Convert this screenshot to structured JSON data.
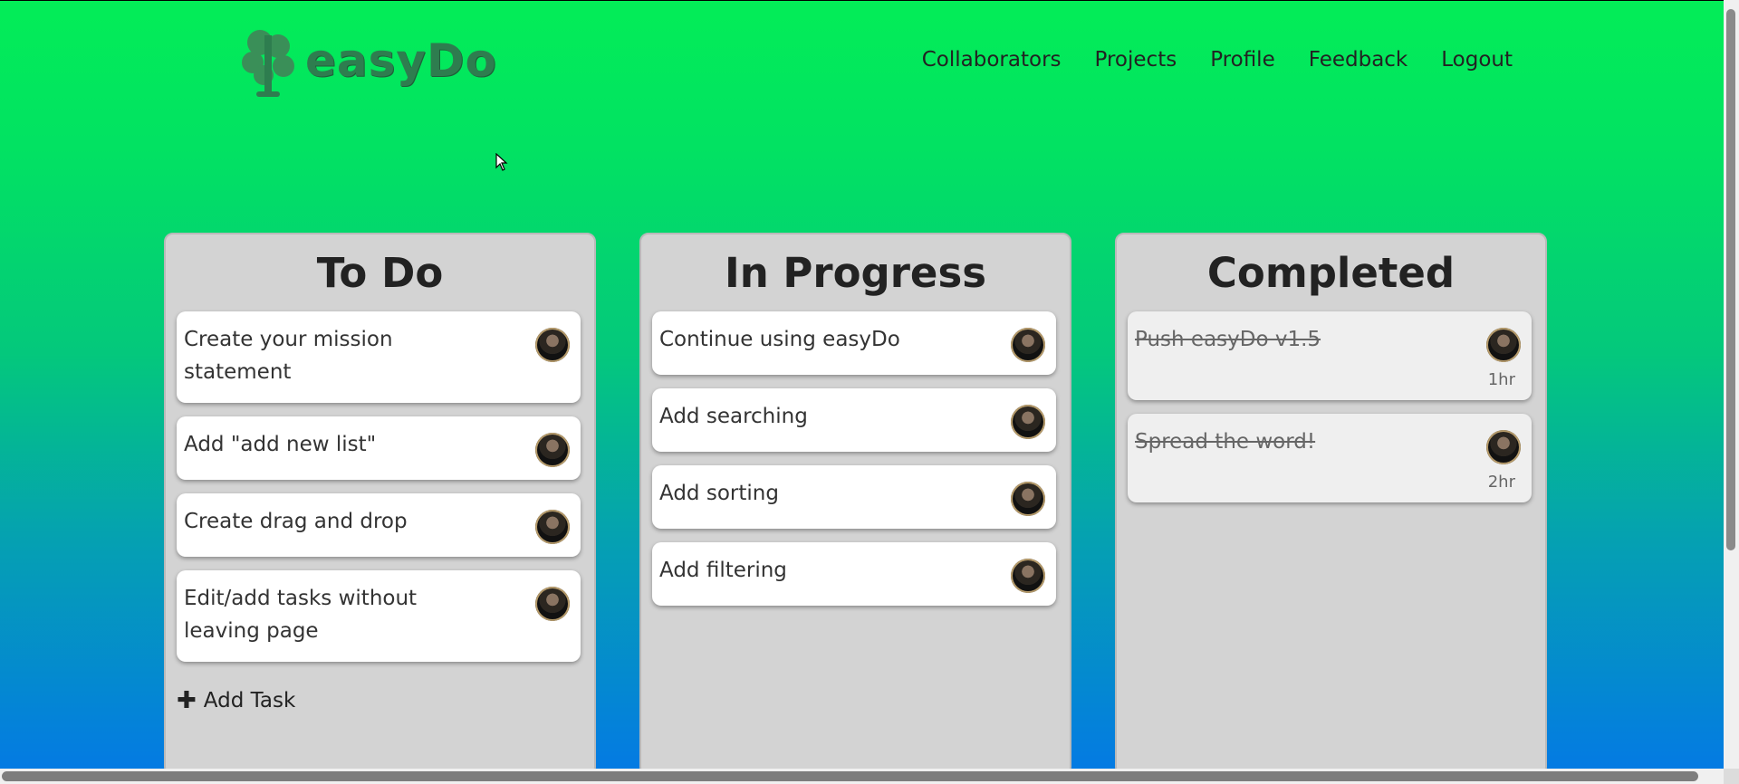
{
  "header": {
    "logo_text": "easyDo",
    "nav": [
      "Collaborators",
      "Projects",
      "Profile",
      "Feedback",
      "Logout"
    ]
  },
  "board": {
    "columns": [
      {
        "title": "To Do",
        "cards": [
          "Create your mission statement",
          "Add \"add new list\"",
          "Create drag and drop",
          "Edit/add tasks without leaving page"
        ],
        "add_task": "Add Task"
      },
      {
        "title": "In Progress",
        "cards": [
          "Continue using easyDo",
          "Add searching",
          "Add sorting",
          "Add filtering"
        ]
      },
      {
        "title": "Completed",
        "cards": [
          {
            "text": "Push easyDo v1.5",
            "time": "1hr"
          },
          {
            "text": "Spread the word!",
            "time": "2hr"
          }
        ]
      }
    ]
  },
  "icons": {
    "logo": "tree-icon",
    "add_task": "plus-icon",
    "avatar": "user-avatar"
  },
  "colors": {
    "background_top": "#03ed57",
    "background_bottom": "#0478e6",
    "logo": "#2e7d4f",
    "column": "#d3d3d3",
    "card": "#ffffff",
    "card_done": "#efefef"
  }
}
